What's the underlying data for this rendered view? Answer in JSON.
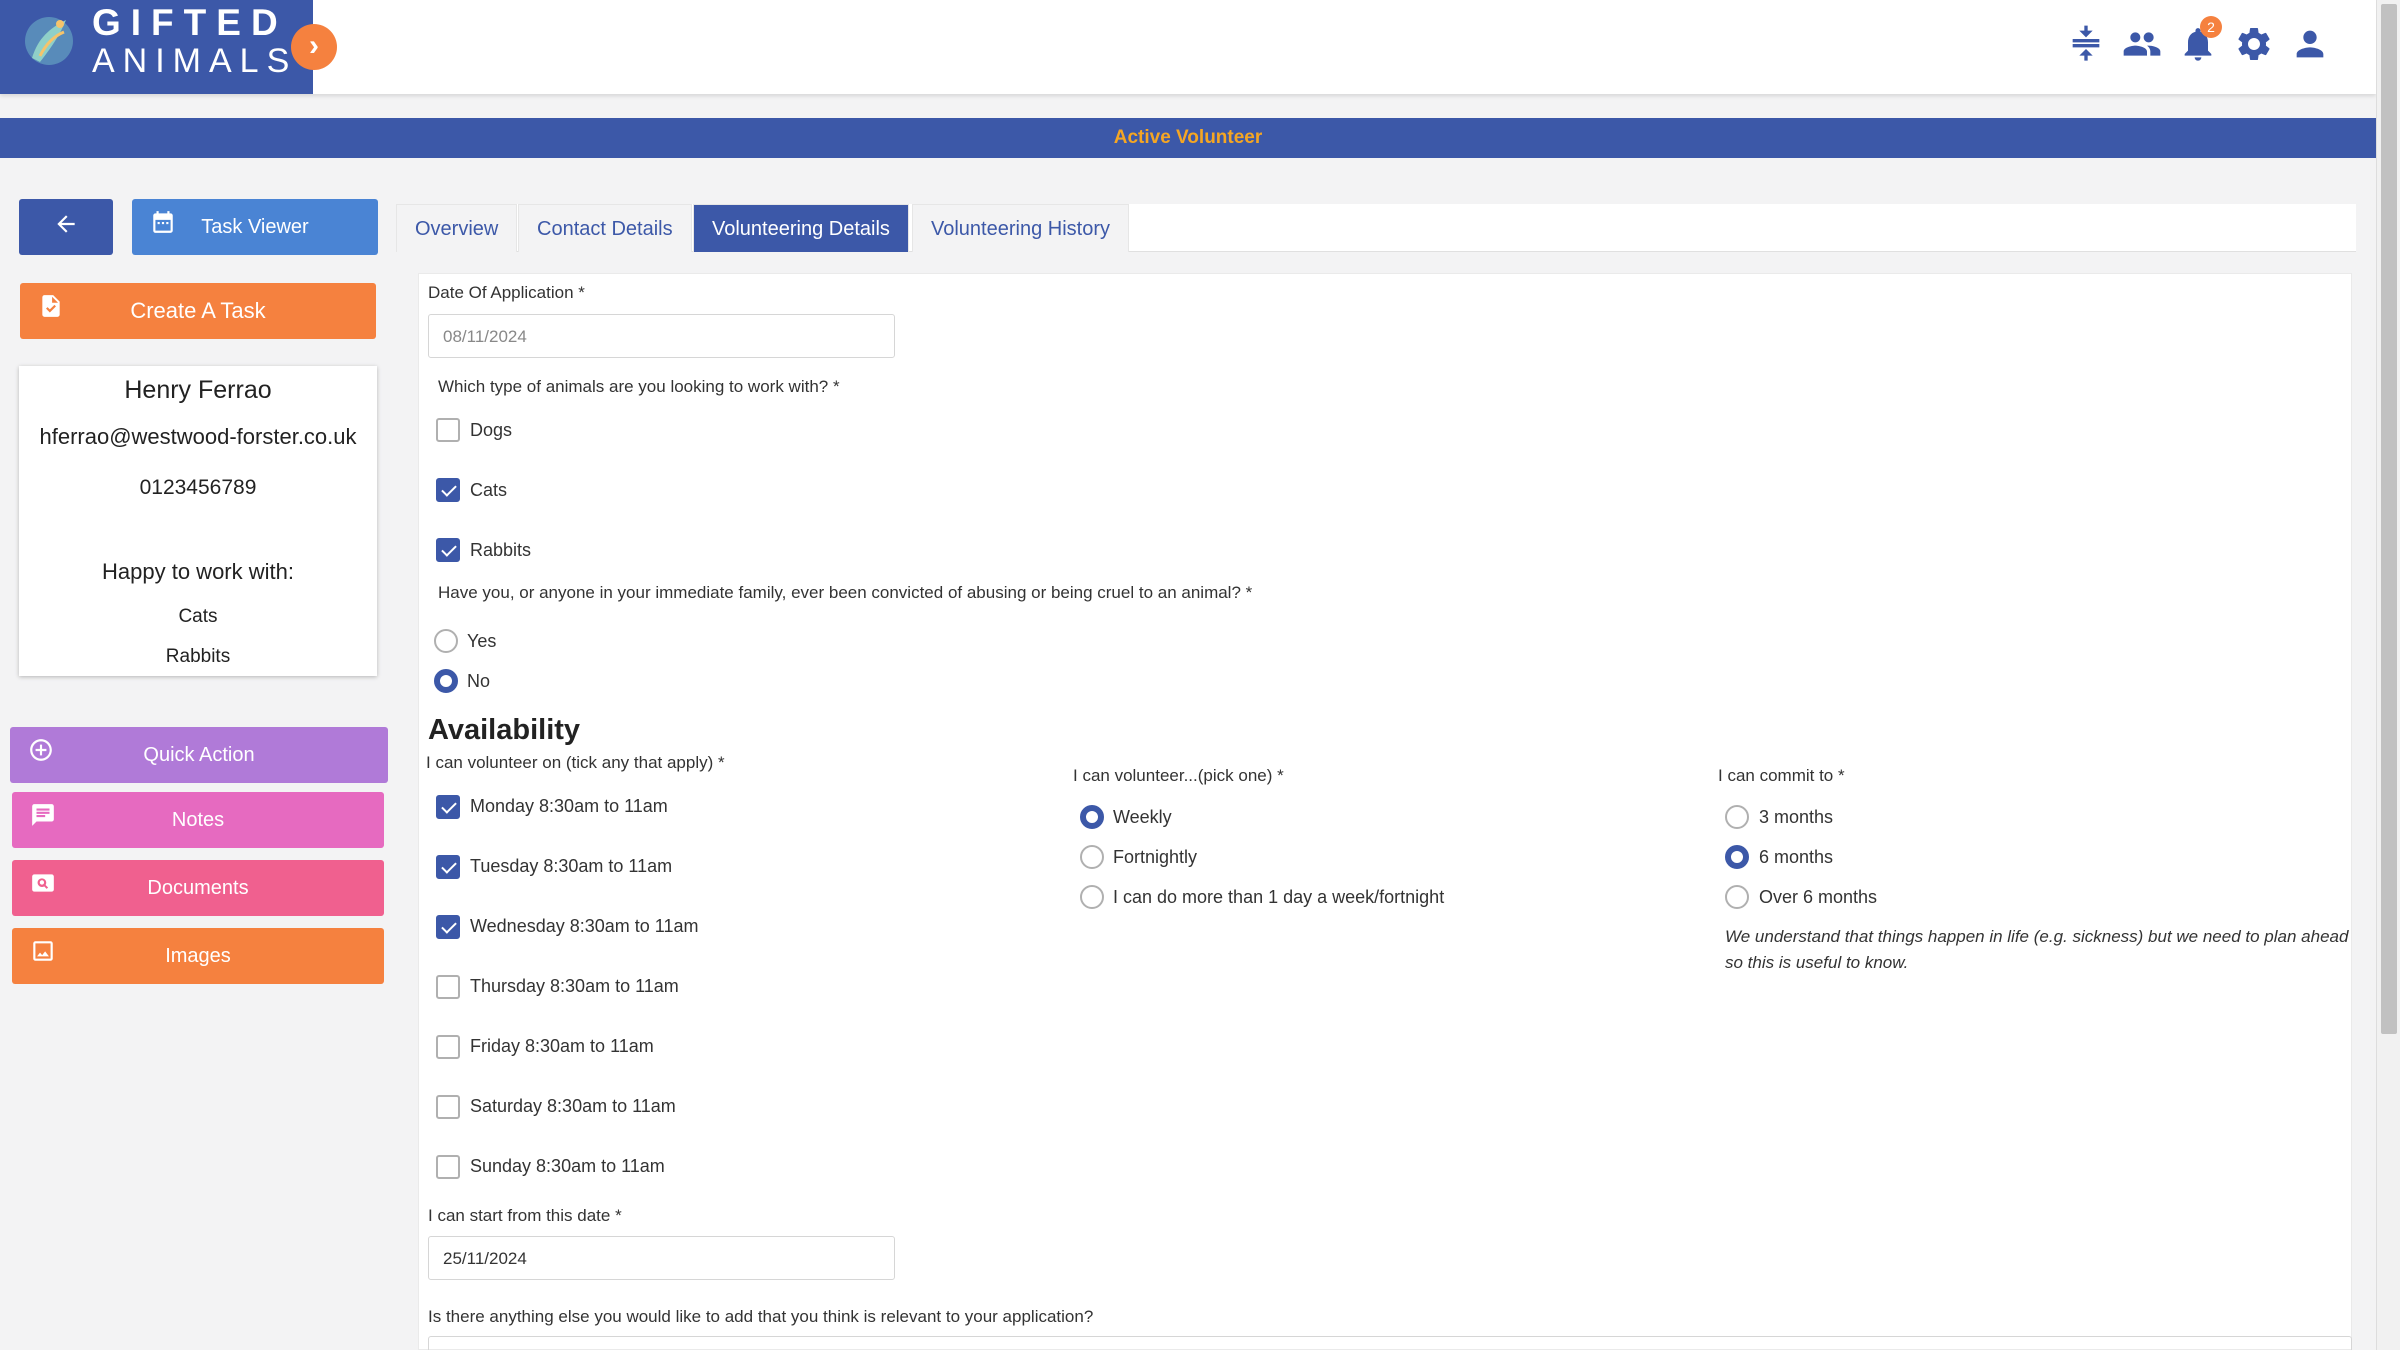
{
  "brand": {
    "line1": "GIFTED",
    "line2": "ANIMALS"
  },
  "header_icons": {
    "notifications_count": "2"
  },
  "status": "Active Volunteer",
  "left_panel": {
    "task_viewer_label": "Task Viewer",
    "create_task_label": "Create A Task",
    "profile": {
      "name": "Henry Ferrao",
      "email": "hferrao@westwood-forster.co.uk",
      "phone": "0123456789",
      "happy_label": "Happy to work with:",
      "animals": [
        "Cats",
        "Rabbits"
      ]
    },
    "quick_action_label": "Quick Action",
    "notes_label": "Notes",
    "documents_label": "Documents",
    "images_label": "Images"
  },
  "tabs": [
    {
      "label": "Overview"
    },
    {
      "label": "Contact Details"
    },
    {
      "label": "Volunteering Details"
    },
    {
      "label": "Volunteering History"
    }
  ],
  "form": {
    "date_of_application_label": "Date Of Application *",
    "date_of_application_placeholder": "08/11/2024",
    "animals_question": "Which type of animals are you looking to work with? *",
    "animal_options": [
      {
        "label": "Dogs",
        "checked": false
      },
      {
        "label": "Cats",
        "checked": true
      },
      {
        "label": "Rabbits",
        "checked": true
      }
    ],
    "conviction_question": "Have you, or anyone in your immediate family, ever been convicted of abusing or being cruel to an animal? *",
    "conviction_options": [
      {
        "label": "Yes",
        "selected": false
      },
      {
        "label": "No",
        "selected": true
      }
    ],
    "availability_heading": "Availability",
    "days_label": "I can volunteer on (tick any that apply) *",
    "day_options": [
      {
        "label": "Monday 8:30am to 11am",
        "checked": true
      },
      {
        "label": "Tuesday 8:30am to 11am",
        "checked": true
      },
      {
        "label": "Wednesday 8:30am to 11am",
        "checked": true
      },
      {
        "label": "Thursday 8:30am to 11am",
        "checked": false
      },
      {
        "label": "Friday 8:30am to 11am",
        "checked": false
      },
      {
        "label": "Saturday 8:30am to 11am",
        "checked": false
      },
      {
        "label": "Sunday 8:30am to 11am",
        "checked": false
      }
    ],
    "frequency_label": "I can volunteer...(pick one) *",
    "frequency_options": [
      {
        "label": "Weekly",
        "selected": true
      },
      {
        "label": "Fortnightly",
        "selected": false
      },
      {
        "label": "I can do more than 1 day a week/fortnight",
        "selected": false
      }
    ],
    "commit_label": "I can commit to *",
    "commit_options": [
      {
        "label": "3 months",
        "selected": false
      },
      {
        "label": "6 months",
        "selected": true
      },
      {
        "label": "Over 6 months",
        "selected": false
      }
    ],
    "commit_note": "We understand that things happen in life (e.g. sickness) but we need to plan ahead so this is useful to know.",
    "start_date_label": "I can start from this date *",
    "start_date_value": "25/11/2024",
    "additional_question": "Is there anything else you would like to add that you think is relevant to your application?"
  }
}
